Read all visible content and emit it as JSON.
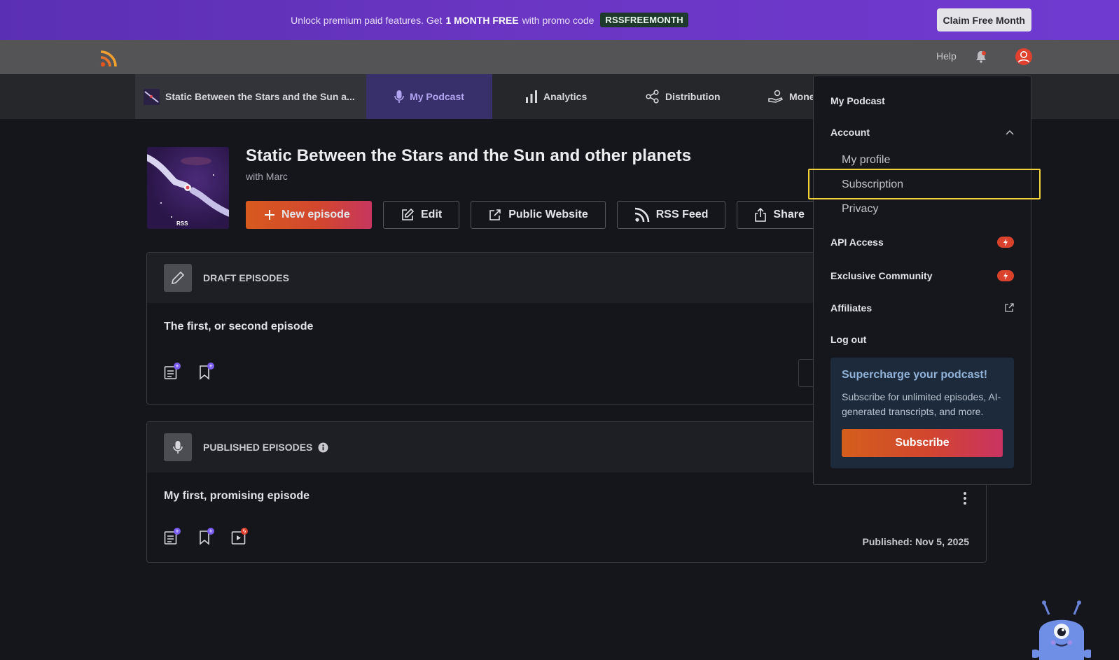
{
  "promo": {
    "text_before": "Unlock premium paid features. Get",
    "text_bold": "1 MONTH FREE",
    "text_after": "with promo code",
    "code": "RSSFREEMONTH",
    "cta": "Claim Free Month"
  },
  "topbar": {
    "help": "Help"
  },
  "nav": {
    "podcast": "Static Between the Stars and the Sun a...",
    "items": [
      "My Podcast",
      "Analytics",
      "Distribution",
      "Mone"
    ]
  },
  "podcast": {
    "title": "Static Between the Stars and the Sun and other planets",
    "subtitle": "with Marc"
  },
  "actions": {
    "new_episode": "New episode",
    "edit": "Edit",
    "public_website": "Public Website",
    "rss_feed": "RSS Feed",
    "share": "Share"
  },
  "drafts": {
    "title": "DRAFT EPISODES",
    "episode": "The first, or second episode"
  },
  "published": {
    "title": "PUBLISHED EPISODES",
    "episode": "My first, promising episode",
    "date": "Published: Nov 5, 2025"
  },
  "dropdown": {
    "my_podcast": "My Podcast",
    "account": "Account",
    "my_profile": "My profile",
    "subscription": "Subscription",
    "privacy": "Privacy",
    "api_access": "API Access",
    "exclusive_community": "Exclusive Community",
    "affiliates": "Affiliates",
    "log_out": "Log out",
    "promo_title": "Supercharge your podcast!",
    "promo_text": "Subscribe for unlimited episodes, AI-generated transcripts, and more.",
    "subscribe": "Subscribe"
  },
  "colors": {
    "accent_purple": "#6b36c4",
    "cta_orange": "#d85a1f",
    "highlight_yellow": "#f2d23a"
  }
}
